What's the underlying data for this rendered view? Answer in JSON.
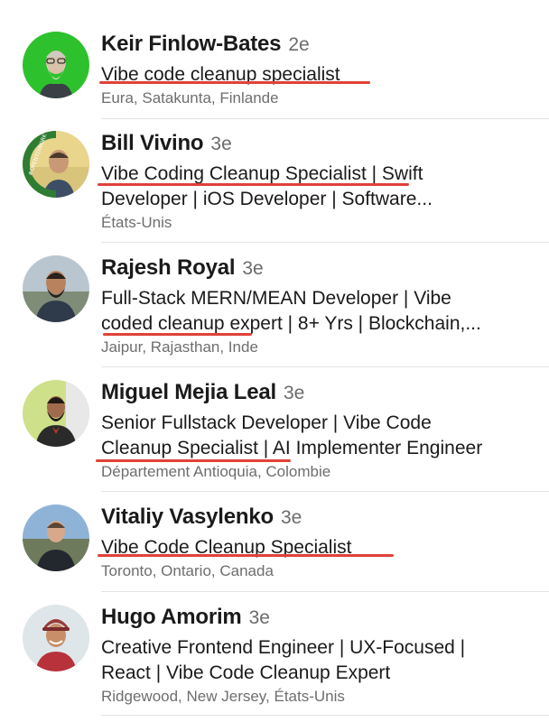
{
  "people": [
    {
      "name": "Keir Finlow-Bates",
      "degree": "2e",
      "headline": [
        "Vibe code cleanup specialist"
      ],
      "location": "Eura, Satakunta, Finlande"
    },
    {
      "name": "Bill Vivino",
      "degree": "3e",
      "headline": [
        "Vibe Coding Cleanup Specialist | Swift",
        "Developer | iOS Developer | Software..."
      ],
      "location": "États-Unis",
      "badge_text": "#OPENTOWORK"
    },
    {
      "name": "Rajesh Royal",
      "degree": "3e",
      "headline": [
        "Full-Stack MERN/MEAN Developer | Vibe",
        "coded cleanup expert | 8+ Yrs | Blockchain,..."
      ],
      "location": "Jaipur, Rajasthan, Inde"
    },
    {
      "name": "Miguel Mejia Leal",
      "degree": "3e",
      "headline": [
        "Senior Fullstack Developer | Vibe Code",
        "Cleanup Specialist | AI Implementer Engineer"
      ],
      "location": "Département Antioquia, Colombie"
    },
    {
      "name": "Vitaliy Vasylenko",
      "degree": "3e",
      "headline": [
        "Vibe Code Cleanup Specialist"
      ],
      "location": "Toronto, Ontario, Canada"
    },
    {
      "name": "Hugo Amorim",
      "degree": "3e",
      "headline": [
        "Creative Frontend Engineer | UX-Focused |",
        "React | Vibe Code Cleanup Expert"
      ],
      "location": "Ridgewood, New Jersey, États-Unis"
    }
  ],
  "colors": {
    "underline": "#e0413a",
    "opentowork": "#2e7d32",
    "avatar_bg_1": "#2ec12e"
  }
}
